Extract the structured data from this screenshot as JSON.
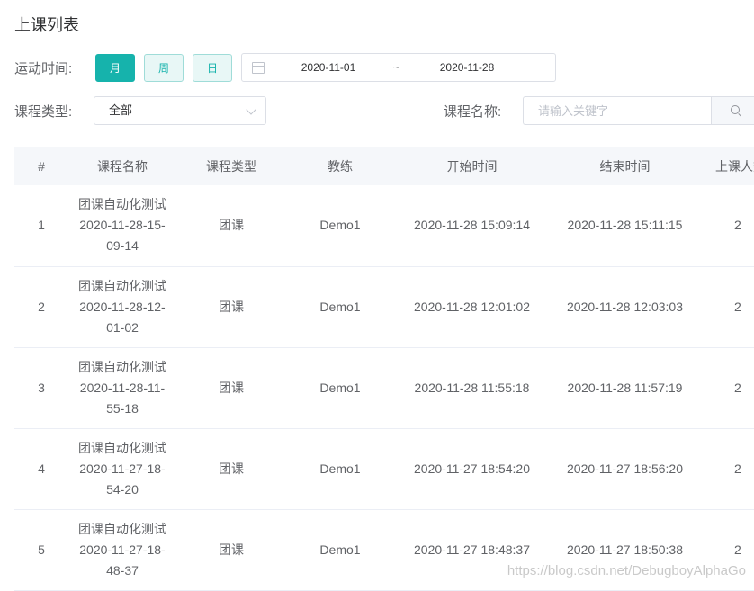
{
  "page": {
    "title": "上课列表"
  },
  "filters": {
    "time_label": "运动时间:",
    "period_buttons": [
      "月",
      "周",
      "日"
    ],
    "active_period": "月",
    "date_start": "2020-11-01",
    "date_separator": "~",
    "date_end": "2020-11-28",
    "type_label": "课程类型:",
    "type_selected": "全部",
    "name_label": "课程名称:",
    "name_placeholder": "请输入关键字"
  },
  "table": {
    "columns": [
      "#",
      "课程名称",
      "课程类型",
      "教练",
      "开始时间",
      "结束时间",
      "上课人数"
    ],
    "rows": [
      {
        "index": "1",
        "name_line1": "团课自动化测试",
        "name_line2": "2020-11-28-15-",
        "name_line3": "09-14",
        "type": "团课",
        "coach": "Demo1",
        "start": "2020-11-28 15:09:14",
        "end": "2020-11-28 15:11:15",
        "count": "2"
      },
      {
        "index": "2",
        "name_line1": "团课自动化测试",
        "name_line2": "2020-11-28-12-",
        "name_line3": "01-02",
        "type": "团课",
        "coach": "Demo1",
        "start": "2020-11-28 12:01:02",
        "end": "2020-11-28 12:03:03",
        "count": "2"
      },
      {
        "index": "3",
        "name_line1": "团课自动化测试",
        "name_line2": "2020-11-28-11-",
        "name_line3": "55-18",
        "type": "团课",
        "coach": "Demo1",
        "start": "2020-11-28 11:55:18",
        "end": "2020-11-28 11:57:19",
        "count": "2"
      },
      {
        "index": "4",
        "name_line1": "团课自动化测试",
        "name_line2": "2020-11-27-18-",
        "name_line3": "54-20",
        "type": "团课",
        "coach": "Demo1",
        "start": "2020-11-27 18:54:20",
        "end": "2020-11-27 18:56:20",
        "count": "2"
      },
      {
        "index": "5",
        "name_line1": "团课自动化测试",
        "name_line2": "2020-11-27-18-",
        "name_line3": "48-37",
        "type": "团课",
        "coach": "Demo1",
        "start": "2020-11-27 18:48:37",
        "end": "2020-11-27 18:50:38",
        "count": "2"
      }
    ]
  },
  "watermark": "https://blog.csdn.net/DebugboyAlphaGo",
  "colors": {
    "accent": "#16b3ac",
    "accent_light": "#e8f7f6",
    "header_bg": "#f5f7fa"
  }
}
